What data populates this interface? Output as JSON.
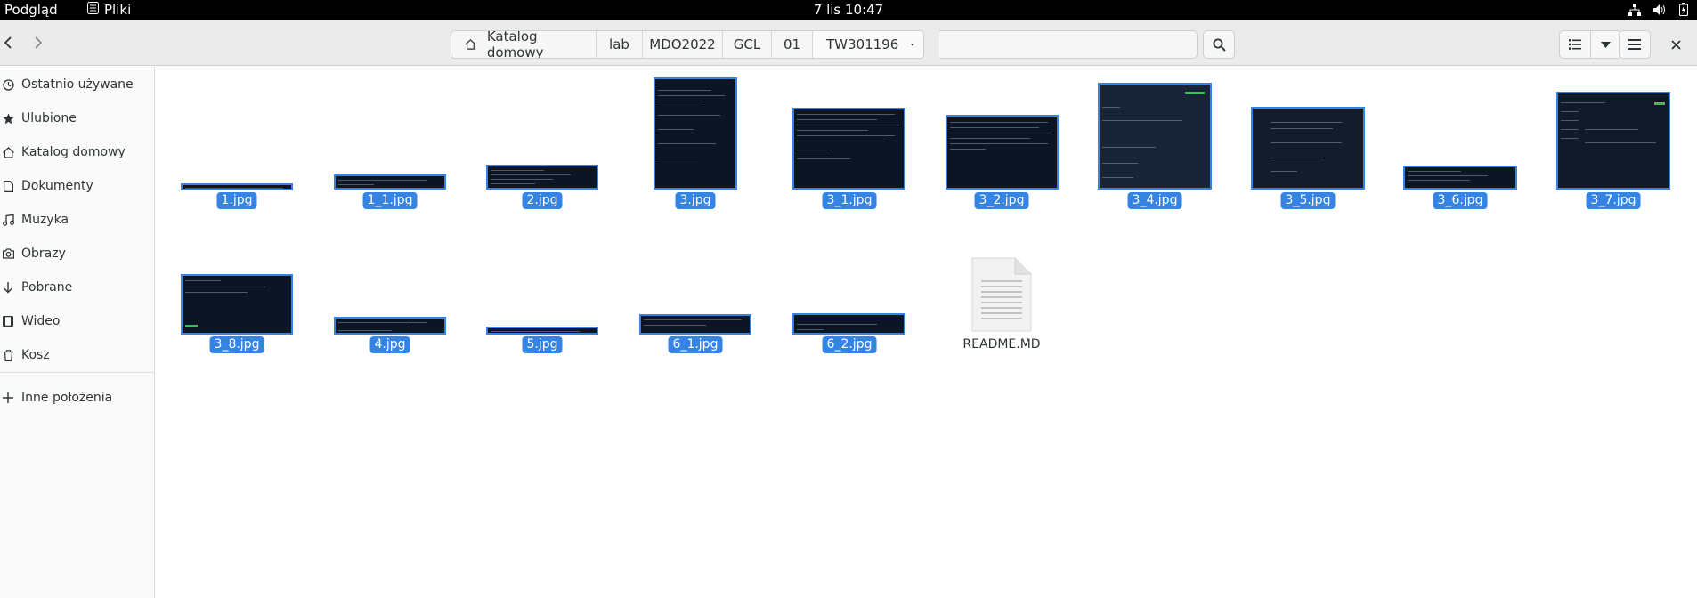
{
  "topbar": {
    "activities": "Podgląd",
    "app_name": "Pliki",
    "clock": "7 lis  10:47"
  },
  "pathbar": {
    "home": "Katalog domowy",
    "segments": [
      "lab",
      "MDO2022",
      "GCL",
      "01",
      "TW301196"
    ]
  },
  "sidebar": {
    "items": [
      {
        "label": "Ostatnio używane",
        "icon": "recent-icon"
      },
      {
        "label": "Ulubione",
        "icon": "star-icon"
      },
      {
        "label": "Katalog domowy",
        "icon": "home-icon"
      },
      {
        "label": "Dokumenty",
        "icon": "document-icon"
      },
      {
        "label": "Muzyka",
        "icon": "music-icon"
      },
      {
        "label": "Obrazy",
        "icon": "camera-icon"
      },
      {
        "label": "Pobrane",
        "icon": "download-icon"
      },
      {
        "label": "Wideo",
        "icon": "video-icon"
      },
      {
        "label": "Kosz",
        "icon": "trash-icon"
      }
    ],
    "other": {
      "label": "Inne położenia",
      "icon": "plus-icon"
    }
  },
  "files": [
    {
      "name": "1.jpg"
    },
    {
      "name": "1_1.jpg"
    },
    {
      "name": "2.jpg"
    },
    {
      "name": "3.jpg"
    },
    {
      "name": "3_1.jpg"
    },
    {
      "name": "3_2.jpg"
    },
    {
      "name": "3_4.jpg"
    },
    {
      "name": "3_5.jpg"
    },
    {
      "name": "3_6.jpg"
    },
    {
      "name": "3_7.jpg"
    },
    {
      "name": "3_8.jpg"
    },
    {
      "name": "4.jpg"
    },
    {
      "name": "5.jpg"
    },
    {
      "name": "6_1.jpg"
    },
    {
      "name": "6_2.jpg"
    },
    {
      "name": "README.MD"
    }
  ],
  "colors": {
    "selection": "#3584e4",
    "thumb_bg": "#0c1524"
  }
}
